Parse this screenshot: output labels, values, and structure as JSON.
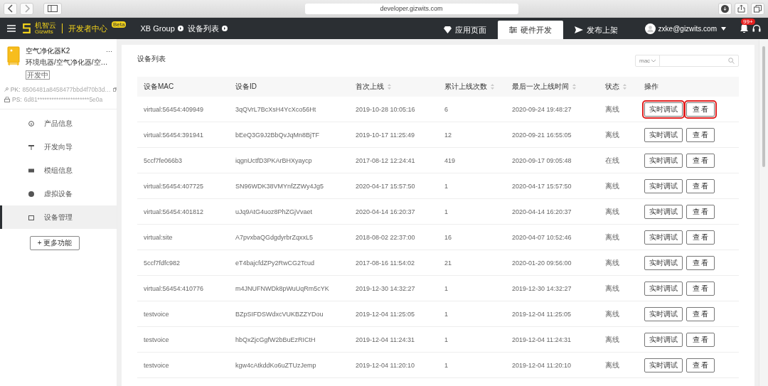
{
  "browser": {
    "url": "developer.gizwits.com"
  },
  "topbar": {
    "logo_cn": "机智云",
    "logo_en": "Gizwits",
    "center_title": "开发者中心",
    "beta": "Beta",
    "breadcrumbs": [
      "XB Group",
      "设备列表"
    ],
    "nav": [
      {
        "label": "应用页面",
        "selected": false
      },
      {
        "label": "硬件开发",
        "selected": true
      },
      {
        "label": "发布上架",
        "selected": false
      }
    ],
    "user": "zxke@gizwits.com",
    "notifications": "99+"
  },
  "sidebar": {
    "product": {
      "name": "空气净化器K2",
      "more": "···",
      "category": "环境电器/空气净化器/空…",
      "status": "开发中"
    },
    "pk": {
      "label": "PK:",
      "value": "8506481a8458477bbd4f70b3d…"
    },
    "ps": {
      "label": "PS:",
      "value": "6d81**********************5e0a"
    },
    "items": [
      {
        "label": "产品信息",
        "selected": false
      },
      {
        "label": "开发向导",
        "selected": false
      },
      {
        "label": "模组信息",
        "selected": false
      },
      {
        "label": "虚拟设备",
        "selected": false
      },
      {
        "label": "设备管理",
        "selected": true
      }
    ],
    "more_button": "+ 更多功能"
  },
  "panel": {
    "title": "设备列表",
    "search": {
      "filter": "mac"
    },
    "table": {
      "columns": [
        {
          "label": "设备MAC",
          "sortable": false
        },
        {
          "label": "设备ID",
          "sortable": false
        },
        {
          "label": "首次上线",
          "sortable": true
        },
        {
          "label": "累计上线次数",
          "sortable": true
        },
        {
          "label": "最后一次上线时间",
          "sortable": true
        },
        {
          "label": "状态",
          "sortable": true
        },
        {
          "label": "操作",
          "sortable": false
        }
      ],
      "rows": [
        {
          "cells": [
            "virtual:56454:409949",
            "3qQVrL7BcXsH4YcXco56Ht",
            "2019-10-28 10:05:16",
            "6",
            "2020-09-24 19:48:27",
            "离线"
          ],
          "actions": [
            {
              "label": "实时调试",
              "highlighted": true
            },
            {
              "label": "查 看",
              "highlighted": true
            }
          ]
        },
        {
          "cells": [
            "virtual:56454:391941",
            "bEeQ3G9J2BbQvJqMn8BjTF",
            "2019-10-17 11:25:49",
            "12",
            "2020-09-21 16:55:05",
            "离线"
          ],
          "actions": [
            {
              "label": "实时调试",
              "highlighted": false
            },
            {
              "label": "查 看",
              "highlighted": false
            }
          ]
        },
        {
          "cells": [
            "5ccf7fe066b3",
            "iqgnUctfD3PKArBHXyaycp",
            "2017-08-12 12:24:41",
            "419",
            "2020-09-17 09:05:48",
            "在线"
          ],
          "actions": [
            {
              "label": "实时调试",
              "highlighted": false
            },
            {
              "label": "查 看",
              "highlighted": false
            }
          ]
        },
        {
          "cells": [
            "virtual:56454:407725",
            "SN96WDK38VMYnfZZWy4Jg5",
            "2020-04-17 15:57:50",
            "1",
            "2020-04-17 15:57:50",
            "离线"
          ],
          "actions": [
            {
              "label": "实时调试",
              "highlighted": false
            },
            {
              "label": "查 看",
              "highlighted": false
            }
          ]
        },
        {
          "cells": [
            "virtual:56454:401812",
            "uJq9AtG4uoz8PhZGjVvaet",
            "2020-04-14 16:20:37",
            "1",
            "2020-04-14 16:20:37",
            "离线"
          ],
          "actions": [
            {
              "label": "实时调试",
              "highlighted": false
            },
            {
              "label": "查 看",
              "highlighted": false
            }
          ]
        },
        {
          "cells": [
            "virtual:site",
            "A7pvxbaQGdgdyrbrZqxxL5",
            "2018-08-02 22:37:00",
            "16",
            "2020-04-07 10:52:46",
            "离线"
          ],
          "actions": [
            {
              "label": "实时调试",
              "highlighted": false
            },
            {
              "label": "查 看",
              "highlighted": false
            }
          ]
        },
        {
          "cells": [
            "5ccf7fdfc982",
            "eT4bajcfdZPy2RwCG2Tcud",
            "2017-08-16 11:54:02",
            "21",
            "2020-01-20 09:56:00",
            "离线"
          ],
          "actions": [
            {
              "label": "实时调试",
              "highlighted": false
            },
            {
              "label": "查 看",
              "highlighted": false
            }
          ]
        },
        {
          "cells": [
            "virtual:56454:410776",
            "m4JNUFNWDk8pWuUqRm5cYK",
            "2019-12-30 14:32:27",
            "1",
            "2019-12-30 14:32:27",
            "离线"
          ],
          "actions": [
            {
              "label": "实时调试",
              "highlighted": false
            },
            {
              "label": "查 看",
              "highlighted": false
            }
          ]
        },
        {
          "cells": [
            "testvoice",
            "BZpSIFDSWdxcVUKBZZYDou",
            "2019-12-04 11:25:05",
            "1",
            "2019-12-04 11:25:05",
            "离线"
          ],
          "actions": [
            {
              "label": "实时调试",
              "highlighted": false
            },
            {
              "label": "查 看",
              "highlighted": false
            }
          ]
        },
        {
          "cells": [
            "testvoice",
            "hbQxZjcGgfW2bBuEzRICtH",
            "2019-12-04 11:24:31",
            "1",
            "2019-12-04 11:24:31",
            "离线"
          ],
          "actions": [
            {
              "label": "实时调试",
              "highlighted": false
            },
            {
              "label": "查 看",
              "highlighted": false
            }
          ]
        },
        {
          "cells": [
            "testvoice",
            "kgw4cAtkddKo6uZTUzJemp",
            "2019-12-04 11:20:10",
            "1",
            "2019-12-04 11:20:10",
            "离线"
          ],
          "actions": [
            {
              "label": "实时调试",
              "highlighted": false
            },
            {
              "label": "查 看",
              "highlighted": false
            }
          ]
        }
      ]
    }
  }
}
